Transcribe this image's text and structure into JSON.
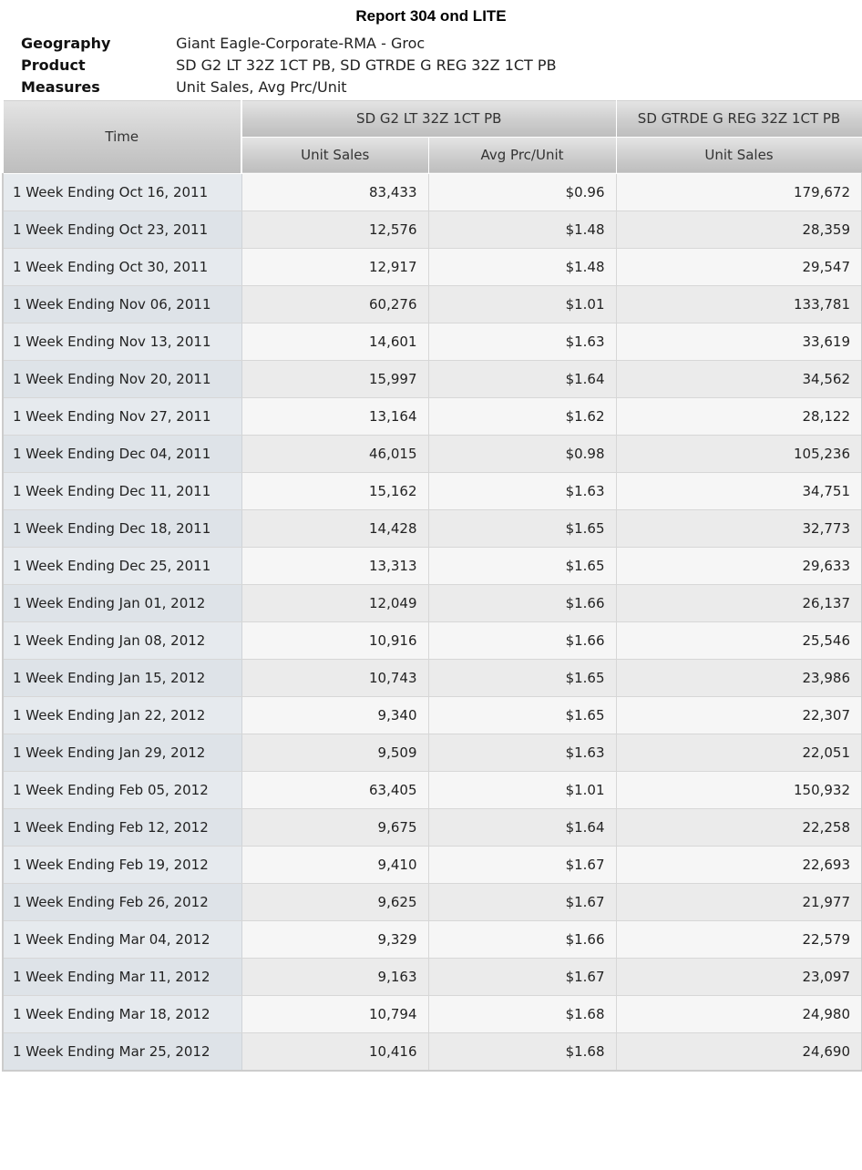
{
  "report": {
    "title": "Report 304 ond LITE"
  },
  "meta": [
    {
      "label": "Geography",
      "value": "Giant Eagle-Corporate-RMA - Groc"
    },
    {
      "label": "Product",
      "value": "SD G2 LT 32Z 1CT PB, SD GTRDE G REG 32Z 1CT PB"
    },
    {
      "label": "Measures",
      "value": "Unit Sales, Avg Prc/Unit"
    }
  ],
  "table": {
    "time_header": "Time",
    "product_headers": [
      "SD G2 LT 32Z 1CT PB",
      "SD GTRDE G REG 32Z 1CT PB"
    ],
    "measure_headers": [
      "Unit Sales",
      "Avg Prc/Unit",
      "Unit Sales"
    ],
    "rows": [
      [
        "1 Week Ending Oct 16, 2011",
        "83,433",
        "$0.96",
        "179,672"
      ],
      [
        "1 Week Ending Oct 23, 2011",
        "12,576",
        "$1.48",
        "28,359"
      ],
      [
        "1 Week Ending Oct 30, 2011",
        "12,917",
        "$1.48",
        "29,547"
      ],
      [
        "1 Week Ending Nov 06, 2011",
        "60,276",
        "$1.01",
        "133,781"
      ],
      [
        "1 Week Ending Nov 13, 2011",
        "14,601",
        "$1.63",
        "33,619"
      ],
      [
        "1 Week Ending Nov 20, 2011",
        "15,997",
        "$1.64",
        "34,562"
      ],
      [
        "1 Week Ending Nov 27, 2011",
        "13,164",
        "$1.62",
        "28,122"
      ],
      [
        "1 Week Ending Dec 04, 2011",
        "46,015",
        "$0.98",
        "105,236"
      ],
      [
        "1 Week Ending Dec 11, 2011",
        "15,162",
        "$1.63",
        "34,751"
      ],
      [
        "1 Week Ending Dec 18, 2011",
        "14,428",
        "$1.65",
        "32,773"
      ],
      [
        "1 Week Ending Dec 25, 2011",
        "13,313",
        "$1.65",
        "29,633"
      ],
      [
        "1 Week Ending Jan 01, 2012",
        "12,049",
        "$1.66",
        "26,137"
      ],
      [
        "1 Week Ending Jan 08, 2012",
        "10,916",
        "$1.66",
        "25,546"
      ],
      [
        "1 Week Ending Jan 15, 2012",
        "10,743",
        "$1.65",
        "23,986"
      ],
      [
        "1 Week Ending Jan 22, 2012",
        "9,340",
        "$1.65",
        "22,307"
      ],
      [
        "1 Week Ending Jan 29, 2012",
        "9,509",
        "$1.63",
        "22,051"
      ],
      [
        "1 Week Ending Feb 05, 2012",
        "63,405",
        "$1.01",
        "150,932"
      ],
      [
        "1 Week Ending Feb 12, 2012",
        "9,675",
        "$1.64",
        "22,258"
      ],
      [
        "1 Week Ending Feb 19, 2012",
        "9,410",
        "$1.67",
        "22,693"
      ],
      [
        "1 Week Ending Feb 26, 2012",
        "9,625",
        "$1.67",
        "21,977"
      ],
      [
        "1 Week Ending Mar 04, 2012",
        "9,329",
        "$1.66",
        "22,579"
      ],
      [
        "1 Week Ending Mar 11, 2012",
        "9,163",
        "$1.67",
        "23,097"
      ],
      [
        "1 Week Ending Mar 18, 2012",
        "10,794",
        "$1.68",
        "24,980"
      ],
      [
        "1 Week Ending Mar 25, 2012",
        "10,416",
        "$1.68",
        "24,690"
      ]
    ]
  }
}
